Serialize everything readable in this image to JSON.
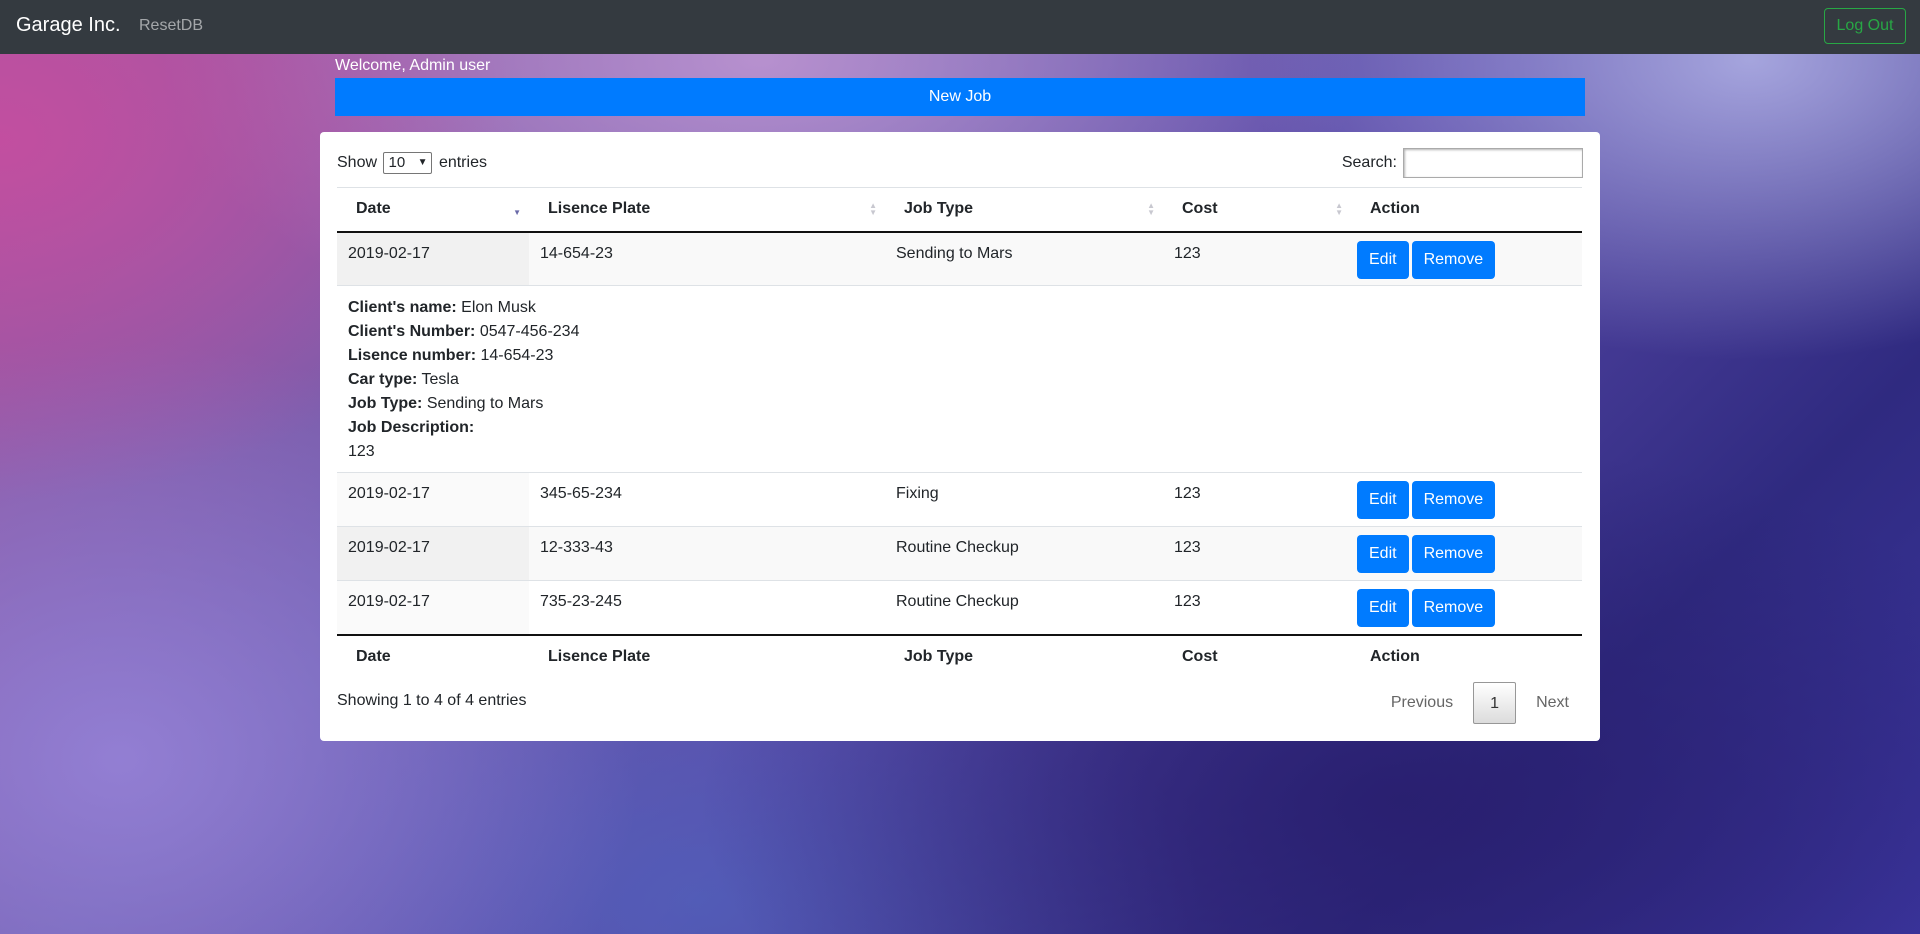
{
  "navbar": {
    "brand": "Garage Inc.",
    "reset_link": "ResetDB",
    "logout_label": "Log Out"
  },
  "welcome": "Welcome, Admin user",
  "new_job_label": "New Job",
  "table_controls": {
    "show_label": "Show",
    "entries_label": "entries",
    "page_length": "10",
    "search_label": "Search:",
    "search_value": ""
  },
  "columns": [
    "Date",
    "Lisence Plate",
    "Job Type",
    "Cost",
    "Action"
  ],
  "rows": [
    {
      "date": "2019-02-17",
      "plate": "14-654-23",
      "job_type": "Sending to Mars",
      "cost": "123"
    },
    {
      "date": "2019-02-17",
      "plate": "345-65-234",
      "job_type": "Fixing",
      "cost": "123"
    },
    {
      "date": "2019-02-17",
      "plate": "12-333-43",
      "job_type": "Routine Checkup",
      "cost": "123"
    },
    {
      "date": "2019-02-17",
      "plate": "735-23-245",
      "job_type": "Routine Checkup",
      "cost": "123"
    }
  ],
  "row_actions": {
    "edit": "Edit",
    "remove": "Remove"
  },
  "details": {
    "client_name_label": "Client's name:",
    "client_name": "Elon Musk",
    "client_number_label": "Client's Number:",
    "client_number": "0547-456-234",
    "lisence_label": "Lisence number:",
    "lisence": "14-654-23",
    "car_type_label": "Car type:",
    "car_type": "Tesla",
    "job_type_label": "Job Type:",
    "job_type": "Sending to Mars",
    "description_label": "Job Description:",
    "description": "123"
  },
  "footer": {
    "info": "Showing 1 to 4 of 4 entries",
    "previous": "Previous",
    "current_page": "1",
    "next": "Next"
  },
  "colors": {
    "navbar": "#343a40",
    "primary": "#007bff",
    "logout": "#28a745"
  }
}
